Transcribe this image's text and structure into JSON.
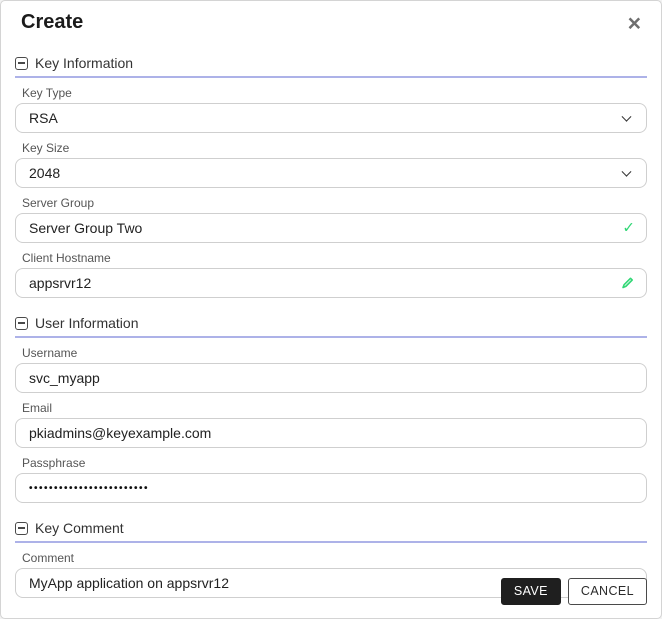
{
  "header": {
    "title": "Create",
    "close_icon": "×"
  },
  "sections": {
    "key_information": {
      "label": "Key Information",
      "fields": {
        "key_type": {
          "label": "Key Type",
          "value": "RSA"
        },
        "key_size": {
          "label": "Key Size",
          "value": "2048"
        },
        "server_group": {
          "label": "Server Group",
          "value": "Server Group Two",
          "status": "valid-check"
        },
        "client_hostname": {
          "label": "Client Hostname",
          "value": "appsrvr12",
          "status": "edit-pencil"
        }
      }
    },
    "user_information": {
      "label": "User Information",
      "fields": {
        "username": {
          "label": "Username",
          "value": "svc_myapp"
        },
        "email": {
          "label": "Email",
          "value": "pkiadmins@keyexample.com"
        },
        "passphrase": {
          "label": "Passphrase",
          "masked_value": "••••••••••••••••••••••••"
        }
      }
    },
    "key_comment": {
      "label": "Key Comment",
      "fields": {
        "comment": {
          "label": "Comment",
          "value": "MyApp application on appsrvr12"
        }
      }
    }
  },
  "icons": {
    "check": "✓"
  },
  "footer": {
    "save_label": "SAVE",
    "cancel_label": "CANCEL"
  },
  "colors": {
    "accent_underline": "#adb2e8",
    "success_green": "#32d776",
    "save_button_bg": "#1f1f1f"
  }
}
